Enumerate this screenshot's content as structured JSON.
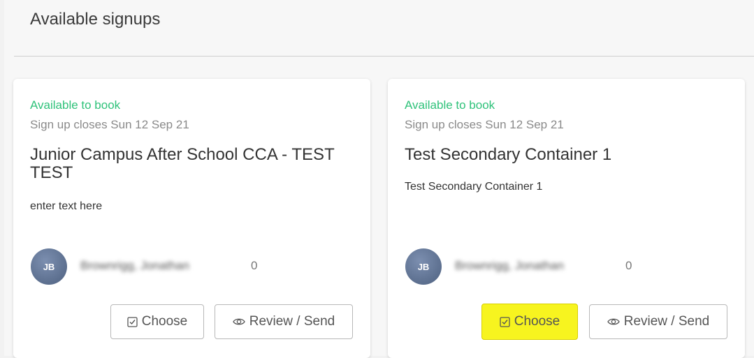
{
  "page": {
    "title": "Available signups"
  },
  "cards": [
    {
      "status": "Available to book",
      "closes": "Sign up closes Sun 12 Sep 21",
      "title": "Junior Campus After School CCA - TEST TEST",
      "description": "enter text here",
      "owner": {
        "initials": "JB",
        "name": "Brownrigg, Jonathan"
      },
      "count": "0",
      "choose_label": "Choose",
      "review_label": "Review / Send"
    },
    {
      "status": "Available to book",
      "closes": "Sign up closes Sun 12 Sep 21",
      "title": "Test Secondary Container 1",
      "description": "Test Secondary Container 1",
      "owner": {
        "initials": "JB",
        "name": "Brownrigg, Jonathan"
      },
      "count": "0",
      "choose_label": "Choose",
      "review_label": "Review / Send"
    }
  ],
  "colors": {
    "status_green": "#2fc27a",
    "highlight_yellow": "#f7f41f"
  },
  "icons": {
    "choose": "checkbox-icon",
    "review": "eye-icon"
  }
}
